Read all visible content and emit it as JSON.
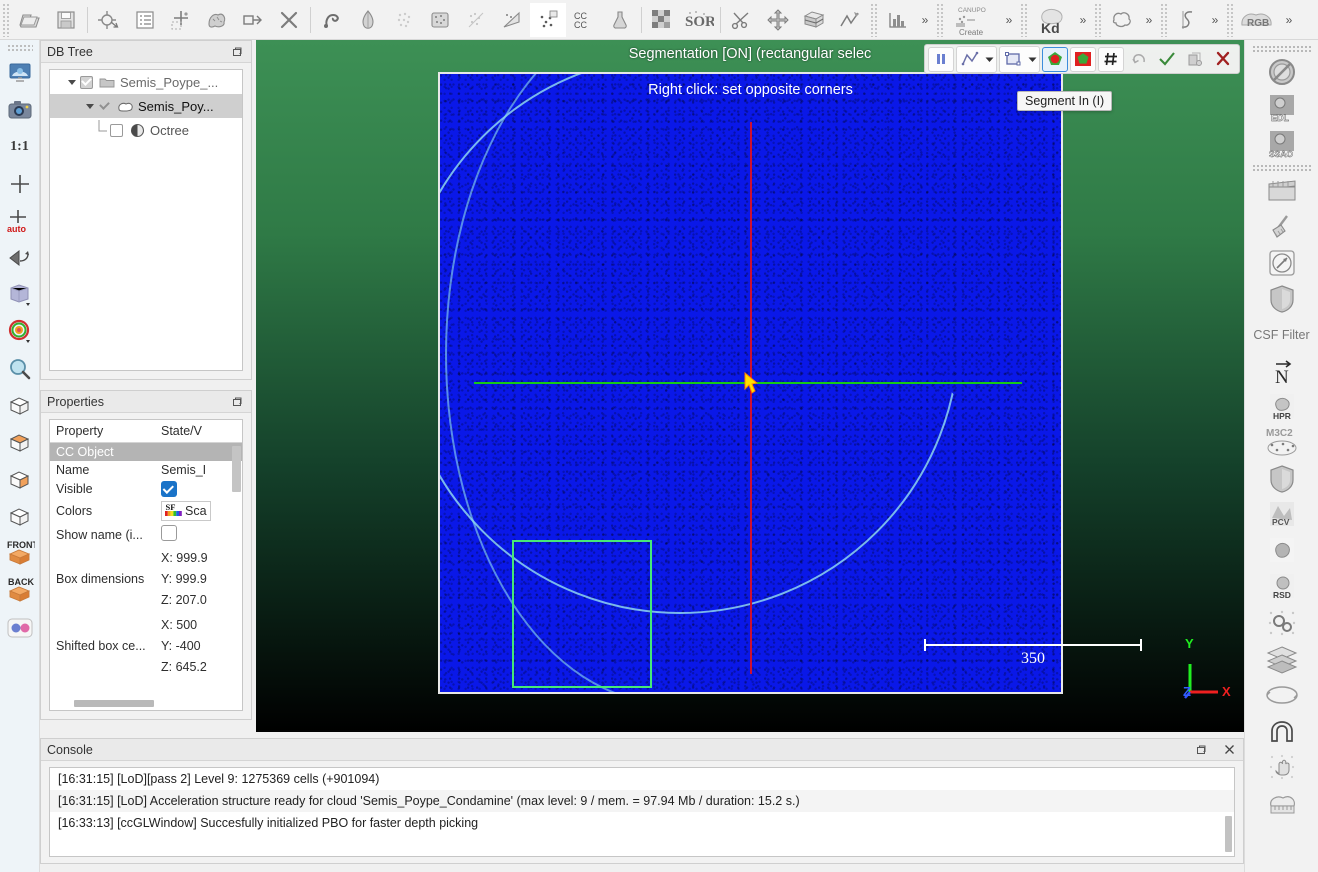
{
  "app": {
    "name": "CloudCompare"
  },
  "top_toolbar": {
    "groups": [
      {
        "name": "main-file-group",
        "buttons": [
          {
            "id": "open",
            "icon": "folder-open-icon",
            "label": "Open"
          },
          {
            "id": "save",
            "icon": "save-floppy-icon",
            "label": "Save"
          },
          {
            "sep": true
          },
          {
            "id": "global-shift",
            "icon": "global-shift-icon",
            "label": "Global shift settings"
          },
          {
            "id": "toggle-db-tree",
            "icon": "list-icon",
            "label": "Toggle DB tree"
          },
          {
            "id": "toggle-properties",
            "icon": "properties-icon",
            "label": "Toggle properties"
          },
          {
            "id": "clone",
            "icon": "clone-icon",
            "label": "Clone"
          },
          {
            "id": "merge",
            "icon": "merge-icon",
            "label": "Merge"
          },
          {
            "id": "delete",
            "icon": "delete-x-icon",
            "label": "Delete"
          },
          {
            "sep": true
          },
          {
            "id": "compute-normals",
            "icon": "normals-icon",
            "label": "Compute normals"
          },
          {
            "id": "color-gradient",
            "icon": "color-gradient-icon",
            "label": "Color gradient"
          },
          {
            "id": "subsample",
            "icon": "subsample-icon",
            "label": "Subsample"
          },
          {
            "id": "mesh",
            "icon": "mesh-icon",
            "label": "Mesh"
          },
          {
            "id": "register",
            "icon": "register-icon",
            "label": "Register clouds"
          },
          {
            "id": "align",
            "icon": "align-icon",
            "label": "Align"
          },
          {
            "id": "cloud-cloud-dist",
            "icon": "cloud-dist-icon",
            "label": "Cloud/Cloud distance"
          },
          {
            "id": "cc-cc",
            "icon": "cc-cc-icon",
            "label": "CC/CC"
          },
          {
            "id": "statistical-test",
            "icon": "flask-icon",
            "label": "Statistical test"
          },
          {
            "sep": true
          },
          {
            "id": "noise-filter",
            "icon": "checker-icon",
            "label": "Noise filter"
          },
          {
            "id": "sor-filter",
            "icon": "sor-icon",
            "label": "SOR filter"
          },
          {
            "sep": true
          },
          {
            "id": "scissors",
            "icon": "scissors-icon",
            "label": "Segment"
          },
          {
            "id": "translate-rotate",
            "icon": "move-icon",
            "label": "Translate/Rotate"
          },
          {
            "id": "clip-box",
            "icon": "clip-box-icon",
            "label": "Cross section"
          },
          {
            "id": "trace-polyline",
            "icon": "polyline-icon",
            "label": "Trace polyline"
          }
        ]
      },
      {
        "name": "histogram-group",
        "buttons": [
          {
            "id": "histogram",
            "icon": "histogram-icon",
            "label": "Histogram"
          }
        ],
        "overflow": "»"
      },
      {
        "name": "canupo-group",
        "buttons": [
          {
            "id": "canupo-create",
            "icon": "canupo-create-icon",
            "label": "CANUPO Create"
          }
        ],
        "overflow": "»"
      },
      {
        "name": "kd-group",
        "buttons": [
          {
            "id": "kd-tree",
            "icon": "kd-icon",
            "label": "Kd"
          }
        ],
        "overflow": "»"
      },
      {
        "name": "plugin-group-1",
        "buttons": [
          {
            "id": "contour-plugin",
            "icon": "contour-icon",
            "label": "Contour"
          }
        ],
        "overflow": "»"
      },
      {
        "name": "plugin-group-2",
        "buttons": [
          {
            "id": "curve-plugin",
            "icon": "curve-s-icon",
            "label": "Curve"
          }
        ],
        "overflow": "»"
      },
      {
        "name": "rgb-group",
        "buttons": [
          {
            "id": "rgb-plugin",
            "icon": "rgb-icon",
            "label": "RGB"
          }
        ],
        "overflow": "»"
      }
    ]
  },
  "left_toolbar": {
    "buttons": [
      {
        "id": "global-zoom",
        "icon": "screen-zoom-icon",
        "label": "Global zoom"
      },
      {
        "id": "snapshot",
        "icon": "camera-icon",
        "label": "Render to file"
      },
      {
        "id": "zoom-1-1",
        "icon": "one-to-one-icon",
        "label": "1:1"
      },
      {
        "id": "pick-rotation-center",
        "icon": "crosshair-icon",
        "label": "Pick rotation center"
      },
      {
        "id": "auto-pick-center",
        "icon": "crosshair-auto-icon",
        "label": "auto"
      },
      {
        "id": "toggle-camera",
        "icon": "camera-flip-icon",
        "label": "Toggle camera mode"
      },
      {
        "id": "point-size",
        "icon": "cube-light-icon",
        "label": "Point size"
      },
      {
        "id": "colors-scale",
        "icon": "color-wheel-icon",
        "label": "Color scale"
      },
      {
        "id": "zoom-tool",
        "icon": "magnifier-icon",
        "label": "Zoom"
      },
      {
        "id": "view-top",
        "icon": "cube-top-icon",
        "label": "Top view"
      },
      {
        "id": "view-iso1",
        "icon": "cube-orange-icon",
        "label": "Isometric view 1"
      },
      {
        "id": "view-bottom",
        "icon": "cube-bottom-icon",
        "label": "Bottom view"
      },
      {
        "id": "view-left",
        "icon": "cube-left-icon",
        "label": "Left view"
      },
      {
        "id": "view-right",
        "icon": "cube-right-icon",
        "label": "Right view"
      },
      {
        "id": "view-front",
        "icon": "cube-front-icon",
        "label": "FRONT"
      },
      {
        "id": "view-back",
        "icon": "cube-back-icon",
        "label": "BACK"
      },
      {
        "id": "stereo-mode",
        "icon": "stereo-icon",
        "label": "Stereo mode"
      }
    ]
  },
  "right_toolbar": {
    "group1": [
      {
        "id": "no-shader",
        "icon": "no-shader-icon",
        "label": "No shader"
      },
      {
        "id": "edl-shader",
        "icon": "edl-icon",
        "label": "EDL"
      },
      {
        "id": "ssao-shader",
        "icon": "ssao-icon",
        "label": "SSAO"
      }
    ],
    "group2": [
      {
        "id": "animation",
        "icon": "clapperboard-icon",
        "label": "Animation"
      },
      {
        "id": "broom",
        "icon": "broom-icon",
        "label": "Clean"
      },
      {
        "id": "compass",
        "icon": "compass-icon",
        "label": "Compass"
      },
      {
        "id": "csf-shield",
        "icon": "shield-icon",
        "label": "CSF"
      },
      {
        "id": "csf-filter",
        "icon": "text-label",
        "label": "CSF Filter"
      },
      {
        "id": "normals-n",
        "icon": "vector-n-icon",
        "label": "N"
      },
      {
        "id": "hpr",
        "icon": "hpr-icon",
        "label": "HPR"
      },
      {
        "id": "m3c2",
        "icon": "m3c2-icon",
        "label": "M3C2"
      },
      {
        "id": "shield2",
        "icon": "shield-icon",
        "label": "Shield"
      },
      {
        "id": "pcv",
        "icon": "pcv-icon",
        "label": "PCV"
      },
      {
        "id": "poisson",
        "icon": "blob-icon",
        "label": "Poisson recon"
      },
      {
        "id": "rsd",
        "icon": "rsd-icon",
        "label": "RSD"
      },
      {
        "id": "gears",
        "icon": "gears-icon",
        "label": "Settings"
      },
      {
        "id": "layers",
        "icon": "layers-icon",
        "label": "Layers"
      },
      {
        "id": "ellipse",
        "icon": "ellipse-icon",
        "label": "Ellipse"
      },
      {
        "id": "arch",
        "icon": "arch-icon",
        "label": "Arch"
      },
      {
        "id": "hand",
        "icon": "hand-icon",
        "label": "Hand"
      },
      {
        "id": "cloud-ruler",
        "icon": "cloud-ruler-icon",
        "label": "Cloud measure"
      }
    ]
  },
  "db_tree": {
    "title": "DB Tree",
    "float_icon": "undock-icon",
    "items": [
      {
        "label": "Semis_Poype_...",
        "depth": 0,
        "icon": "folder-icon",
        "expanded": true,
        "checked": true,
        "selected": false,
        "check_style": "grey"
      },
      {
        "label": "Semis_Poy...",
        "depth": 1,
        "icon": "cloud-icon",
        "expanded": true,
        "checked": true,
        "selected": true,
        "check_style": "light"
      },
      {
        "label": "Octree",
        "depth": 2,
        "icon": "octree-icon",
        "expanded": false,
        "checked": false,
        "selected": false,
        "check_style": "empty"
      }
    ]
  },
  "properties": {
    "title": "Properties",
    "float_icon": "undock-icon",
    "headers": [
      "Property",
      "State/V"
    ],
    "section": "CC Object",
    "rows": [
      {
        "name": "Name",
        "value": "Semis_I",
        "type": "text"
      },
      {
        "name": "Visible",
        "value": "",
        "type": "checkbox-checked"
      },
      {
        "name": "Colors",
        "value": "Sca",
        "type": "sf-chip"
      },
      {
        "name": "Show name (i...",
        "value": "",
        "type": "checkbox-empty"
      },
      {
        "name": "Box dimensions",
        "value": [
          "X: 999.9",
          "Y: 999.9",
          "Z: 207.0"
        ],
        "type": "multiline"
      },
      {
        "name": "Shifted box ce...",
        "value": [
          "X: 500",
          "Y: -400",
          "Z: 645.2"
        ],
        "type": "multiline"
      }
    ]
  },
  "viewport": {
    "title": "Segmentation [ON] (rectangular selec",
    "cloud_hint": "Right click: set opposite corners",
    "tooltip": "Segment In (I)",
    "scalebar_value": "350",
    "axis": {
      "x": "X",
      "y": "Y",
      "z": "Z"
    },
    "colors": {
      "cloud": "#0a18e8",
      "crosshair_vertical": "#cf1030",
      "crosshair_horizontal": "#18c818",
      "selection_rect": "#46e878",
      "axis_x": "#ff2020",
      "axis_y": "#20ff20",
      "axis_z": "#2060ff",
      "background_top": "#3d9055",
      "background_bottom": "#000000"
    },
    "toolbar": [
      {
        "id": "pause",
        "icon": "pause-icon",
        "label": "Pause segmentation",
        "style": "boxed"
      },
      {
        "id": "polyline-select",
        "icon": "polyline-select-icon",
        "label": "Polyline selection",
        "style": "combo"
      },
      {
        "id": "rect-select",
        "icon": "rect-select-icon",
        "label": "Rectangular selection",
        "style": "combo"
      },
      {
        "id": "segment-in",
        "icon": "segment-in-icon",
        "label": "Segment In (I)",
        "style": "active"
      },
      {
        "id": "segment-out",
        "icon": "segment-out-icon",
        "label": "Segment Out (O)",
        "style": "boxed"
      },
      {
        "id": "use-existing-poly",
        "icon": "hash-icon",
        "label": "Use existing polyline",
        "style": "boxed"
      },
      {
        "id": "undo",
        "icon": "undo-icon",
        "label": "Undo",
        "style": "flat"
      },
      {
        "id": "validate",
        "icon": "check-icon",
        "label": "Confirm segmentation",
        "style": "flat"
      },
      {
        "id": "validate-delete",
        "icon": "confirm-delete-icon",
        "label": "Confirm and delete hidden",
        "style": "flat"
      },
      {
        "id": "cancel",
        "icon": "cancel-x-icon",
        "label": "Cancel",
        "style": "flat"
      }
    ]
  },
  "console": {
    "title": "Console",
    "float_icon": "undock-icon",
    "close_icon": "close-icon",
    "lines": [
      "[16:31:15] [LoD][pass 2] Level 9: 1275369 cells (+901094)",
      "[16:31:15] [LoD] Acceleration structure ready for cloud 'Semis_Poype_Condamine' (max level: 9 / mem. = 97.94 Mb / duration: 15.2 s.)",
      "[16:33:13] [ccGLWindow] Succesfully initialized PBO for faster depth picking"
    ]
  }
}
